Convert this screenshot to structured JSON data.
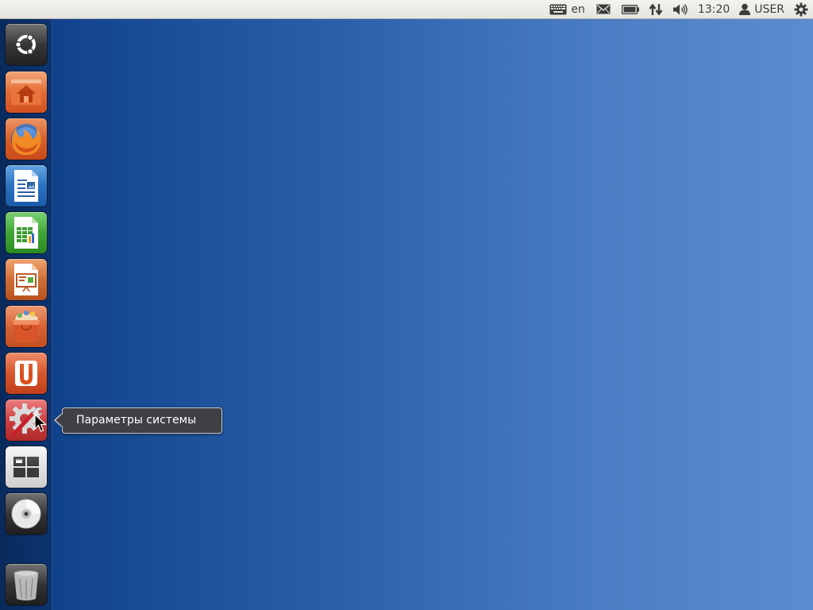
{
  "top_panel": {
    "language": "en",
    "clock": "13:20",
    "user": "USER"
  },
  "launcher": {
    "items": [
      {
        "name": "dash-home",
        "icon": "ubuntu-logo-icon"
      },
      {
        "name": "home-folder",
        "icon": "home-folder-icon"
      },
      {
        "name": "firefox",
        "icon": "firefox-icon"
      },
      {
        "name": "libreoffice-writer",
        "icon": "writer-icon"
      },
      {
        "name": "libreoffice-calc",
        "icon": "calc-icon"
      },
      {
        "name": "libreoffice-impress",
        "icon": "impress-icon"
      },
      {
        "name": "software-center",
        "icon": "software-center-icon"
      },
      {
        "name": "ubuntu-one",
        "icon": "ubuntu-one-icon"
      },
      {
        "name": "system-settings",
        "icon": "settings-icon"
      },
      {
        "name": "workspace-switcher",
        "icon": "workspace-icon"
      },
      {
        "name": "dvd",
        "icon": "disc-icon"
      },
      {
        "name": "trash",
        "icon": "trash-icon"
      }
    ]
  },
  "tooltip": {
    "text": "Параметры системы"
  },
  "colors": {
    "desktop_left": "#0b3d86",
    "desktop_right": "#5a8cd0",
    "panel": "#e6e4df",
    "tooltip_bg": "#3e4045"
  }
}
